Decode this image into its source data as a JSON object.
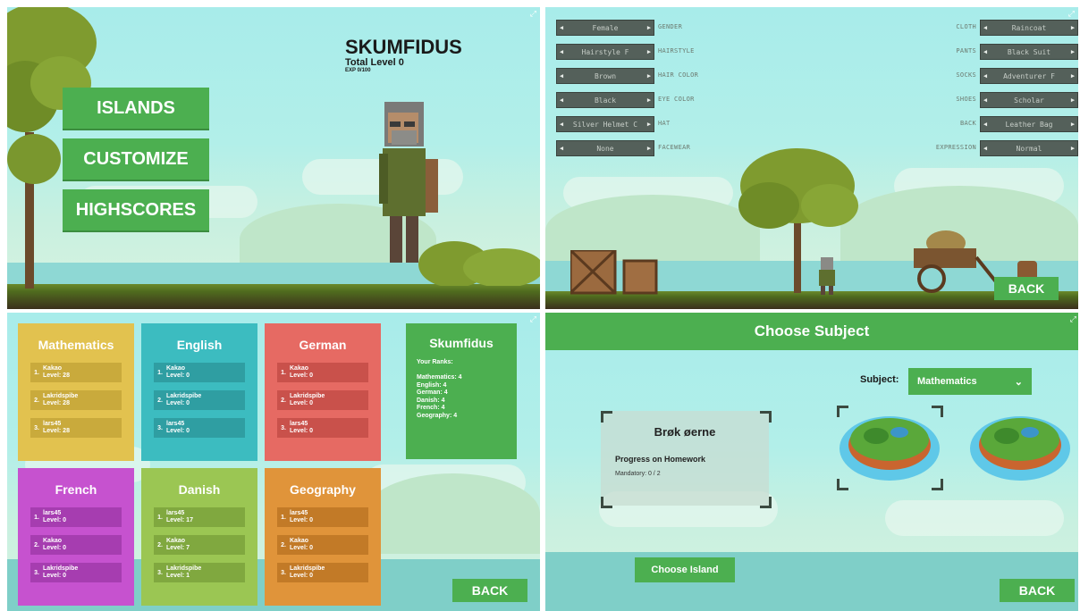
{
  "main_menu": {
    "player_name": "SKUMFIDUS",
    "total_level": "Total Level 0",
    "exp": "EXP 0/100",
    "buttons": [
      "ISLANDS",
      "CUSTOMIZE",
      "HIGHSCORES"
    ]
  },
  "customize": {
    "left": [
      {
        "value": "Female",
        "label": "GENDER"
      },
      {
        "value": "Hairstyle F",
        "label": "HAIRSTYLE"
      },
      {
        "value": "Brown",
        "label": "HAIR COLOR"
      },
      {
        "value": "Black",
        "label": "EYE COLOR"
      },
      {
        "value": "Silver Helmet C",
        "label": "HAT"
      },
      {
        "value": "None",
        "label": "FACEWEAR"
      }
    ],
    "right": [
      {
        "value": "Raincoat",
        "label": "CLOTH"
      },
      {
        "value": "Black Suit",
        "label": "PANTS"
      },
      {
        "value": "Adventurer F",
        "label": "SOCKS"
      },
      {
        "value": "Scholar",
        "label": "SHOES"
      },
      {
        "value": "Leather Bag",
        "label": "BACK"
      },
      {
        "value": "Normal",
        "label": "EXPRESSION"
      }
    ],
    "back_label": "BACK"
  },
  "highscores": {
    "cards": [
      {
        "title": "Mathematics",
        "color": "#e2c24f",
        "row_color": "#c9aa3c",
        "entries": [
          {
            "rank": "1.",
            "name": "Kakao",
            "level": "Level: 28"
          },
          {
            "rank": "2.",
            "name": "Lakridspibe",
            "level": "Level: 28"
          },
          {
            "rank": "3.",
            "name": "lars45",
            "level": "Level: 28"
          }
        ]
      },
      {
        "title": "English",
        "color": "#3cbcc0",
        "row_color": "#2f9ea2",
        "entries": [
          {
            "rank": "1.",
            "name": "Kakao",
            "level": "Level: 0"
          },
          {
            "rank": "2.",
            "name": "Lakridspibe",
            "level": "Level: 0"
          },
          {
            "rank": "3.",
            "name": "lars45",
            "level": "Level: 0"
          }
        ]
      },
      {
        "title": "German",
        "color": "#e66a63",
        "row_color": "#c9514b",
        "entries": [
          {
            "rank": "1.",
            "name": "Kakao",
            "level": "Level: 0"
          },
          {
            "rank": "2.",
            "name": "Lakridspibe",
            "level": "Level: 0"
          },
          {
            "rank": "3.",
            "name": "lars45",
            "level": "Level: 0"
          }
        ]
      },
      {
        "title": "French",
        "color": "#c652cf",
        "row_color": "#a63db0",
        "entries": [
          {
            "rank": "1.",
            "name": "lars45",
            "level": "Level: 0"
          },
          {
            "rank": "2.",
            "name": "Kakao",
            "level": "Level: 0"
          },
          {
            "rank": "3.",
            "name": "Lakridspibe",
            "level": "Level: 0"
          }
        ]
      },
      {
        "title": "Danish",
        "color": "#9bc653",
        "row_color": "#80a83f",
        "entries": [
          {
            "rank": "1.",
            "name": "lars45",
            "level": "Level: 17"
          },
          {
            "rank": "2.",
            "name": "Kakao",
            "level": "Level: 7"
          },
          {
            "rank": "3.",
            "name": "Lakridspibe",
            "level": "Level: 1"
          }
        ]
      },
      {
        "title": "Geography",
        "color": "#e0943a",
        "row_color": "#c27a27",
        "entries": [
          {
            "rank": "1.",
            "name": "lars45",
            "level": "Level: 0"
          },
          {
            "rank": "2.",
            "name": "Kakao",
            "level": "Level: 0"
          },
          {
            "rank": "3.",
            "name": "Lakridspibe",
            "level": "Level: 0"
          }
        ]
      }
    ],
    "player": {
      "name": "Skumfidus",
      "your_ranks": "Your Ranks:",
      "ranks": [
        "Mathematics: 4",
        "English: 4",
        "German: 4",
        "Danish: 4",
        "French: 4",
        "Geography: 4"
      ]
    },
    "back_label": "BACK"
  },
  "choose_subject": {
    "title": "Choose Subject",
    "subject_label": "Subject:",
    "subject_value": "Mathematics",
    "island_name": "Brøk øerne",
    "progress_label": "Progress on Homework",
    "mandatory": "Mandatory: 0 / 2",
    "choose_island_label": "Choose Island",
    "back_label": "BACK"
  },
  "colors": {
    "accent_green": "#4caf50",
    "sky": "#a8ecea"
  }
}
